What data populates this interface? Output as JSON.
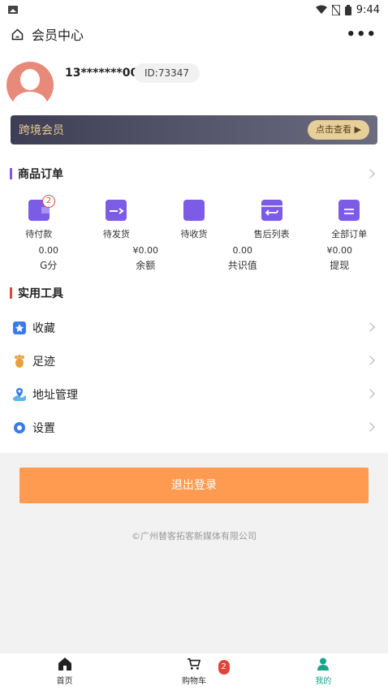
{
  "statusbar": {
    "time": "9:44"
  },
  "header": {
    "title": "会员中心",
    "more": "•••"
  },
  "profile": {
    "phone": "13*******00",
    "id": "ID:73347"
  },
  "vip": {
    "label": "跨境会员",
    "button": "点击查看 ▶"
  },
  "orders_section": {
    "title": "商品订单",
    "items": [
      {
        "label": "待付款",
        "badge": "2"
      },
      {
        "label": "待发货"
      },
      {
        "label": "待收货"
      },
      {
        "label": "售后列表"
      },
      {
        "label": "全部订单"
      }
    ]
  },
  "stats": [
    {
      "value": "0.00",
      "label": "G分"
    },
    {
      "value": "¥0.00",
      "label": "余额"
    },
    {
      "value": "0.00",
      "label": "共识值"
    },
    {
      "value": "¥0.00",
      "label": "提现"
    }
  ],
  "tools_section": {
    "title": "实用工具",
    "items": [
      {
        "label": "收藏"
      },
      {
        "label": "足迹"
      },
      {
        "label": "地址管理"
      },
      {
        "label": "设置"
      }
    ]
  },
  "logout": "退出登录",
  "copyright": "©广州替客拓客新媒体有限公司",
  "tabbar": {
    "items": [
      {
        "label": "首页"
      },
      {
        "label": "购物车",
        "badge": "2"
      },
      {
        "label": "我的"
      }
    ]
  },
  "colors": {
    "accent_purple": "#7c5ce6",
    "logout": "#fe9b50",
    "tools_red": "#e0453a",
    "active_tab": "#1aa58a"
  }
}
